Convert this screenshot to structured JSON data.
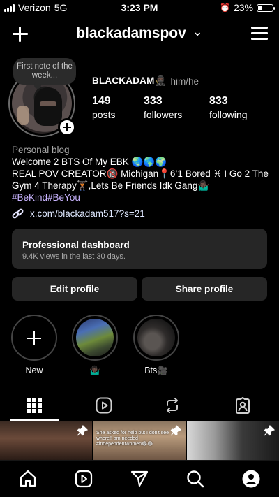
{
  "status_bar": {
    "carrier": "Verizon",
    "network": "5G",
    "time": "3:23 PM",
    "battery": "23%",
    "battery_level": 0.23
  },
  "header": {
    "username": "blackadamspov",
    "dropdown_glyph": "⌄"
  },
  "profile": {
    "note": "First note of the week...",
    "display_name": "BLACKADAM🥷🏿",
    "pronouns": "him/he",
    "stats": [
      {
        "value": "149",
        "label": "posts"
      },
      {
        "value": "333",
        "label": "followers"
      },
      {
        "value": "833",
        "label": "following"
      }
    ],
    "category": "Personal blog",
    "bio_line1": "Welcome 2 BTS Of My EBK 🌏🌎🌍",
    "bio_line2": "REAL POV CREATOR🔞 Michigan📍6’1 Bored ♓ I Go 2 The Gym 4 Therapy🏋🏿,Lets Be Friends Idk Gang🤷🏿‍♂️",
    "hashtags": "#BeKind#BeYou",
    "link": "x.com/blackadam517?s=21"
  },
  "dashboard": {
    "title": "Professional dashboard",
    "subtitle": "9.4K views in the last 30 days."
  },
  "buttons": {
    "edit": "Edit profile",
    "share": "Share profile"
  },
  "highlights": [
    {
      "label": "New"
    },
    {
      "label": "🤷🏿‍♂️"
    },
    {
      "label": "Bts🎥"
    }
  ],
  "grid": {
    "post2_caption": "She asked for help but I don't see where!! am needed #independentwomen😂😂"
  },
  "icons": {
    "create": "plus-icon",
    "menu": "hamburger-menu-icon",
    "link": "link-icon",
    "tabs": [
      "grid-icon",
      "reels-icon",
      "reposts-icon",
      "tagged-icon"
    ],
    "nav": [
      "home-icon",
      "reels-icon",
      "send-icon",
      "search-icon",
      "profile-icon"
    ]
  },
  "colors": {
    "background": "#000000",
    "card": "#262626",
    "hashtag": "#c9b4ff",
    "secondary_text": "#a8a8a8"
  }
}
